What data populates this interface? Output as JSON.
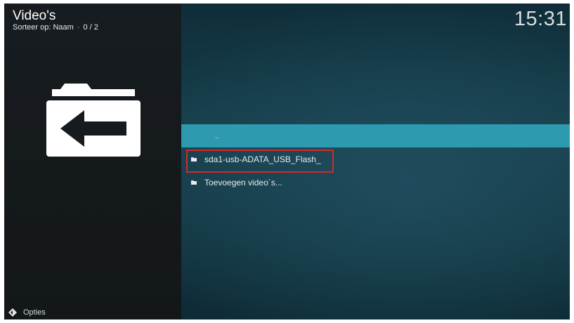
{
  "header": {
    "title": "Video's",
    "sort_label": "Sorteer op: Naam",
    "separator": "·",
    "count": "0 / 2"
  },
  "clock": "15:31",
  "list": {
    "parent_label": "..",
    "items": [
      {
        "label": "sda1-usb-ADATA_USB_Flash_",
        "icon": "folder-icon",
        "selected": true
      },
      {
        "label": "Toevoegen video´s...",
        "icon": "folder-icon",
        "selected": false
      }
    ]
  },
  "footer": {
    "options_label": "Opties",
    "options_icon": "options-icon"
  },
  "colors": {
    "accent": "#2e9aaf",
    "highlight_border": "#d02a2e",
    "left_panel": "#171c20",
    "right_panel": "#18414f"
  }
}
